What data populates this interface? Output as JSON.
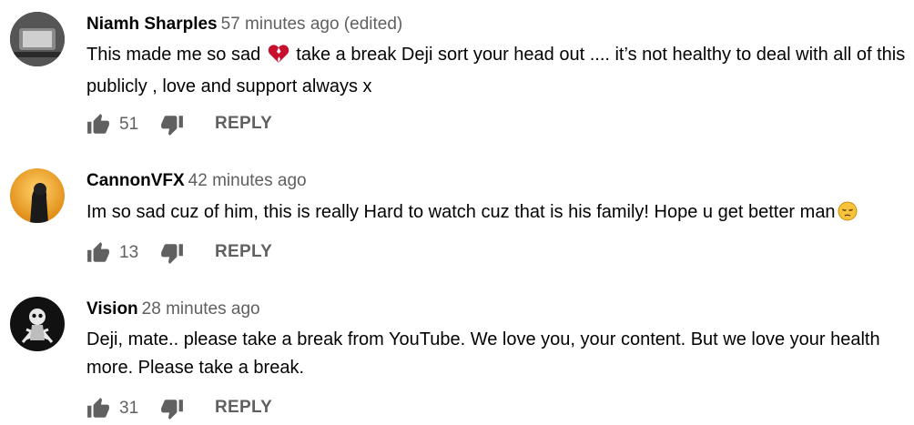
{
  "comments": [
    {
      "author": "Niamh Sharples",
      "meta": "57 minutes ago (edited)",
      "text_before": "This made me so sad ",
      "emoji": "broken-heart-emoji",
      "text_after": " take a break Deji sort your head out .... it’s not healthy to deal with all of this publicly , love and support always x",
      "likes": "51",
      "reply": "REPLY"
    },
    {
      "author": "CannonVFX",
      "meta": "42 minutes ago",
      "text_before": "Im so sad cuz of him, this is really Hard to watch cuz that is his family! Hope u get better man",
      "emoji": "pensive-face-emoji",
      "text_after": "",
      "likes": "13",
      "reply": "REPLY"
    },
    {
      "author": "Vision",
      "meta": "28 minutes ago",
      "text_before": "Deji, mate.. please take a break from YouTube. We love you, your content. But we love your health more. Please take a break.",
      "emoji": "",
      "text_after": "",
      "likes": "31",
      "reply": "REPLY"
    }
  ],
  "colors": {
    "author": "#030303",
    "meta": "#606060",
    "icon": "#606060",
    "broken_heart": "#c8102e",
    "pensive_face": "#f6c33a"
  },
  "icons": [
    "thumb-up-icon",
    "thumb-down-icon",
    "broken-heart-emoji",
    "pensive-face-emoji"
  ]
}
